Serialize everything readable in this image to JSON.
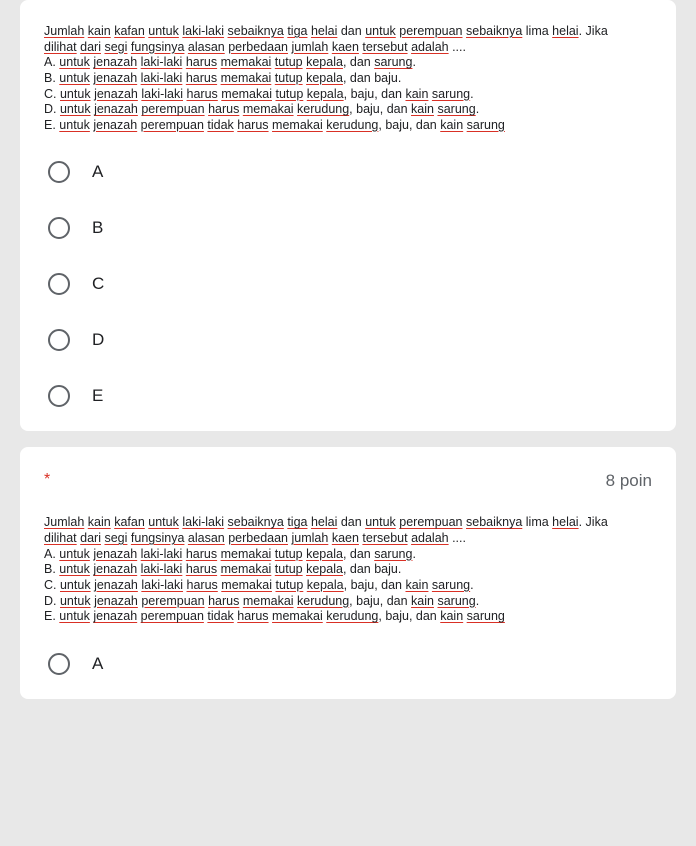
{
  "q1": {
    "text_runs": [
      {
        "t": "Jumlah",
        "u": 1
      },
      {
        "t": " "
      },
      {
        "t": "kain",
        "u": 1
      },
      {
        "t": " "
      },
      {
        "t": "kafan",
        "u": 1
      },
      {
        "t": " "
      },
      {
        "t": "untuk",
        "u": 1
      },
      {
        "t": " "
      },
      {
        "t": "laki-laki",
        "u": 1
      },
      {
        "t": " "
      },
      {
        "t": "sebaiknya",
        "u": 1
      },
      {
        "t": " "
      },
      {
        "t": "tiga",
        "u": 1
      },
      {
        "t": " "
      },
      {
        "t": "helai",
        "u": 1
      },
      {
        "t": " dan "
      },
      {
        "t": "untuk",
        "u": 1
      },
      {
        "t": " "
      },
      {
        "t": "perempuan",
        "u": 1
      },
      {
        "t": " "
      },
      {
        "t": "sebaiknya",
        "u": 1
      },
      {
        "t": " lima "
      },
      {
        "t": "helai",
        "u": 1
      },
      {
        "t": ". Jika "
      },
      {
        "br": 1
      },
      {
        "t": "dilihat",
        "u": 1
      },
      {
        "t": " "
      },
      {
        "t": "dari",
        "u": 1
      },
      {
        "t": " "
      },
      {
        "t": "segi",
        "u": 1
      },
      {
        "t": " "
      },
      {
        "t": "fungsinya",
        "u": 1
      },
      {
        "t": " "
      },
      {
        "t": "alasan",
        "u": 1
      },
      {
        "t": " "
      },
      {
        "t": "perbedaan",
        "u": 1
      },
      {
        "t": " "
      },
      {
        "t": "jumlah",
        "u": 1
      },
      {
        "t": " "
      },
      {
        "t": "kaen",
        "u": 1
      },
      {
        "t": " "
      },
      {
        "t": "tersebut",
        "u": 1
      },
      {
        "t": " "
      },
      {
        "t": "adalah",
        "u": 1
      },
      {
        "t": " ...."
      },
      {
        "br": 1
      },
      {
        "t": "A.   "
      },
      {
        "t": "untuk",
        "u": 1
      },
      {
        "t": " "
      },
      {
        "t": "jenazah",
        "u": 1
      },
      {
        "t": " "
      },
      {
        "t": "laki-laki",
        "u": 1
      },
      {
        "t": " "
      },
      {
        "t": "harus",
        "u": 1
      },
      {
        "t": " "
      },
      {
        "t": "memakai",
        "u": 1
      },
      {
        "t": " "
      },
      {
        "t": "tutup",
        "u": 1
      },
      {
        "t": " "
      },
      {
        "t": "kepala",
        "u": 1
      },
      {
        "t": ", dan "
      },
      {
        "t": "sarung",
        "u": 1
      },
      {
        "t": "."
      },
      {
        "br": 1
      },
      {
        "t": "B.   "
      },
      {
        "t": "untuk",
        "u": 1
      },
      {
        "t": " "
      },
      {
        "t": "jenazah",
        "u": 1
      },
      {
        "t": " "
      },
      {
        "t": "laki-laki",
        "u": 1
      },
      {
        "t": " "
      },
      {
        "t": "harus",
        "u": 1
      },
      {
        "t": " "
      },
      {
        "t": "memakai",
        "u": 1
      },
      {
        "t": " "
      },
      {
        "t": "tutup",
        "u": 1
      },
      {
        "t": " "
      },
      {
        "t": "kepala",
        "u": 1
      },
      {
        "t": ", dan baju."
      },
      {
        "br": 1
      },
      {
        "t": "C.   "
      },
      {
        "t": "untuk",
        "u": 1
      },
      {
        "t": " "
      },
      {
        "t": "jenazah",
        "u": 1
      },
      {
        "t": " "
      },
      {
        "t": "laki-laki",
        "u": 1
      },
      {
        "t": " "
      },
      {
        "t": "harus",
        "u": 1
      },
      {
        "t": " "
      },
      {
        "t": "memakai",
        "u": 1
      },
      {
        "t": " "
      },
      {
        "t": "tutup",
        "u": 1
      },
      {
        "t": " "
      },
      {
        "t": "kepala",
        "u": 1
      },
      {
        "t": ", baju, dan "
      },
      {
        "t": "kain",
        "u": 1
      },
      {
        "t": " "
      },
      {
        "t": "sarung",
        "u": 1
      },
      {
        "t": "."
      },
      {
        "br": 1
      },
      {
        "t": "D.   "
      },
      {
        "t": "untuk",
        "u": 1
      },
      {
        "t": " "
      },
      {
        "t": "jenazah",
        "u": 1
      },
      {
        "t": " "
      },
      {
        "t": "perempuan",
        "u": 1
      },
      {
        "t": " "
      },
      {
        "t": "harus",
        "u": 1
      },
      {
        "t": " "
      },
      {
        "t": "memakai",
        "u": 1
      },
      {
        "t": " "
      },
      {
        "t": "kerudung",
        "u": 1
      },
      {
        "t": ", baju, dan "
      },
      {
        "t": "kain",
        "u": 1
      },
      {
        "t": " "
      },
      {
        "t": "sarung",
        "u": 1
      },
      {
        "t": "."
      },
      {
        "br": 1
      },
      {
        "t": "E.   "
      },
      {
        "t": "untuk",
        "u": 1
      },
      {
        "t": " "
      },
      {
        "t": "jenazah",
        "u": 1
      },
      {
        "t": " "
      },
      {
        "t": "perempuan",
        "u": 1
      },
      {
        "t": " "
      },
      {
        "t": "tidak",
        "u": 1
      },
      {
        "t": " "
      },
      {
        "t": "harus",
        "u": 1
      },
      {
        "t": " "
      },
      {
        "t": "memakai",
        "u": 1
      },
      {
        "t": " "
      },
      {
        "t": "kerudung",
        "u": 1
      },
      {
        "t": ", baju, dan "
      },
      {
        "t": "kain",
        "u": 1
      },
      {
        "t": " "
      },
      {
        "t": "sarung",
        "u": 1
      }
    ],
    "options": [
      {
        "label": "A"
      },
      {
        "label": "B"
      },
      {
        "label": "C"
      },
      {
        "label": "D"
      },
      {
        "label": "E"
      }
    ]
  },
  "q2": {
    "required_mark": "*",
    "points": "8 poin",
    "text_runs": [
      {
        "t": "Jumlah",
        "u": 1
      },
      {
        "t": " "
      },
      {
        "t": "kain",
        "u": 1
      },
      {
        "t": " "
      },
      {
        "t": "kafan",
        "u": 1
      },
      {
        "t": " "
      },
      {
        "t": "untuk",
        "u": 1
      },
      {
        "t": " "
      },
      {
        "t": "laki-laki",
        "u": 1
      },
      {
        "t": " "
      },
      {
        "t": "sebaiknya",
        "u": 1
      },
      {
        "t": " "
      },
      {
        "t": "tiga",
        "u": 1
      },
      {
        "t": " "
      },
      {
        "t": "helai",
        "u": 1
      },
      {
        "t": " dan "
      },
      {
        "t": "untuk",
        "u": 1
      },
      {
        "t": " "
      },
      {
        "t": "perempuan",
        "u": 1
      },
      {
        "t": " "
      },
      {
        "t": "sebaiknya",
        "u": 1
      },
      {
        "t": " lima "
      },
      {
        "t": "helai",
        "u": 1
      },
      {
        "t": ". Jika "
      },
      {
        "br": 1
      },
      {
        "t": "dilihat",
        "u": 1
      },
      {
        "t": " "
      },
      {
        "t": "dari",
        "u": 1
      },
      {
        "t": " "
      },
      {
        "t": "segi",
        "u": 1
      },
      {
        "t": " "
      },
      {
        "t": "fungsinya",
        "u": 1
      },
      {
        "t": " "
      },
      {
        "t": "alasan",
        "u": 1
      },
      {
        "t": " "
      },
      {
        "t": "perbedaan",
        "u": 1
      },
      {
        "t": " "
      },
      {
        "t": "jumlah",
        "u": 1
      },
      {
        "t": " "
      },
      {
        "t": "kaen",
        "u": 1
      },
      {
        "t": " "
      },
      {
        "t": "tersebut",
        "u": 1
      },
      {
        "t": " "
      },
      {
        "t": "adalah",
        "u": 1
      },
      {
        "t": " ...."
      },
      {
        "br": 1
      },
      {
        "t": "A.   "
      },
      {
        "t": "untuk",
        "u": 1
      },
      {
        "t": " "
      },
      {
        "t": "jenazah",
        "u": 1
      },
      {
        "t": " "
      },
      {
        "t": "laki-laki",
        "u": 1
      },
      {
        "t": " "
      },
      {
        "t": "harus",
        "u": 1
      },
      {
        "t": " "
      },
      {
        "t": "memakai",
        "u": 1
      },
      {
        "t": " "
      },
      {
        "t": "tutup",
        "u": 1
      },
      {
        "t": " "
      },
      {
        "t": "kepala",
        "u": 1
      },
      {
        "t": ", dan "
      },
      {
        "t": "sarung",
        "u": 1
      },
      {
        "t": "."
      },
      {
        "br": 1
      },
      {
        "t": "B.   "
      },
      {
        "t": "untuk",
        "u": 1
      },
      {
        "t": " "
      },
      {
        "t": "jenazah",
        "u": 1
      },
      {
        "t": " "
      },
      {
        "t": "laki-laki",
        "u": 1
      },
      {
        "t": " "
      },
      {
        "t": "harus",
        "u": 1
      },
      {
        "t": " "
      },
      {
        "t": "memakai",
        "u": 1
      },
      {
        "t": " "
      },
      {
        "t": "tutup",
        "u": 1
      },
      {
        "t": " "
      },
      {
        "t": "kepala",
        "u": 1
      },
      {
        "t": ", dan baju."
      },
      {
        "br": 1
      },
      {
        "t": "C.   "
      },
      {
        "t": "untuk",
        "u": 1
      },
      {
        "t": " "
      },
      {
        "t": "jenazah",
        "u": 1
      },
      {
        "t": " "
      },
      {
        "t": "laki-laki",
        "u": 1
      },
      {
        "t": " "
      },
      {
        "t": "harus",
        "u": 1
      },
      {
        "t": " "
      },
      {
        "t": "memakai",
        "u": 1
      },
      {
        "t": " "
      },
      {
        "t": "tutup",
        "u": 1
      },
      {
        "t": " "
      },
      {
        "t": "kepala",
        "u": 1
      },
      {
        "t": ", baju, dan "
      },
      {
        "t": "kain",
        "u": 1
      },
      {
        "t": " "
      },
      {
        "t": "sarung",
        "u": 1
      },
      {
        "t": "."
      },
      {
        "br": 1
      },
      {
        "t": "D.   "
      },
      {
        "t": "untuk",
        "u": 1
      },
      {
        "t": " "
      },
      {
        "t": "jenazah",
        "u": 1
      },
      {
        "t": " "
      },
      {
        "t": "perempuan",
        "u": 1
      },
      {
        "t": " "
      },
      {
        "t": "harus",
        "u": 1
      },
      {
        "t": " "
      },
      {
        "t": "memakai",
        "u": 1
      },
      {
        "t": " "
      },
      {
        "t": "kerudung",
        "u": 1
      },
      {
        "t": ", baju, dan "
      },
      {
        "t": "kain",
        "u": 1
      },
      {
        "t": " "
      },
      {
        "t": "sarung",
        "u": 1
      },
      {
        "t": "."
      },
      {
        "br": 1
      },
      {
        "t": "E.   "
      },
      {
        "t": "untuk",
        "u": 1
      },
      {
        "t": " "
      },
      {
        "t": "jenazah",
        "u": 1
      },
      {
        "t": " "
      },
      {
        "t": "perempuan",
        "u": 1
      },
      {
        "t": " "
      },
      {
        "t": "tidak",
        "u": 1
      },
      {
        "t": " "
      },
      {
        "t": "harus",
        "u": 1
      },
      {
        "t": " "
      },
      {
        "t": "memakai",
        "u": 1
      },
      {
        "t": " "
      },
      {
        "t": "kerudung",
        "u": 1
      },
      {
        "t": ", baju, dan "
      },
      {
        "t": "kain",
        "u": 1
      },
      {
        "t": " "
      },
      {
        "t": "sarung",
        "u": 1
      }
    ],
    "options": [
      {
        "label": "A"
      }
    ]
  }
}
